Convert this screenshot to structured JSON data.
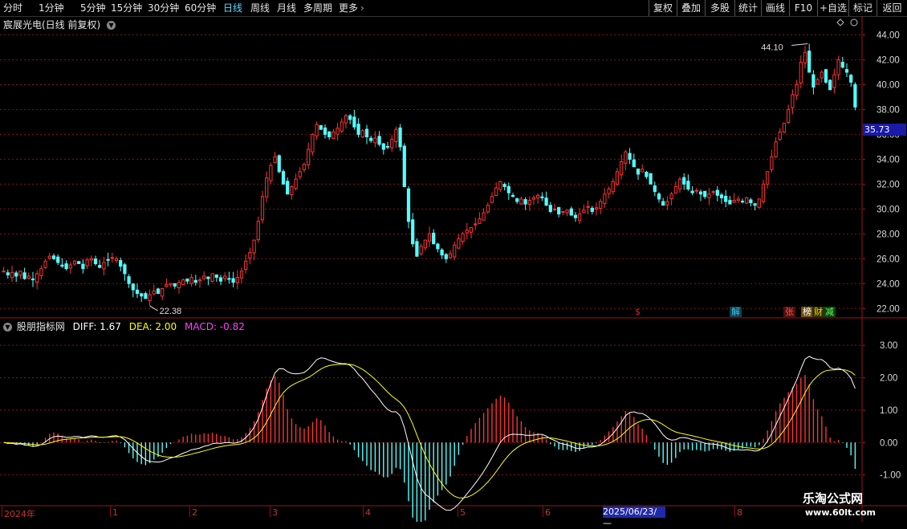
{
  "toolbar": {
    "periods": [
      "分时",
      "1分钟",
      "5分钟",
      "15分钟",
      "30分钟",
      "60分钟",
      "日线",
      "周线",
      "月线",
      "多周期",
      "更多"
    ],
    "active_period": "日线",
    "right_buttons": [
      "复权",
      "叠加",
      "多股",
      "统计",
      "画线",
      "F10",
      "+自选",
      "标记",
      "返回"
    ]
  },
  "stock": {
    "title": "宸展光电(日线 前复权)",
    "current_price_tag": "35.73"
  },
  "indicator": {
    "name": "股朋指标网",
    "diff": "DIFF: 1.67",
    "dea": "DEA: 2.00",
    "macd": "MACD: -0.82"
  },
  "annotations": {
    "high_label": "44.10",
    "low_label": "22.38"
  },
  "badges": [
    {
      "text": "$",
      "color": "#e02020",
      "bg": "transparent"
    },
    {
      "text": "解",
      "color": "#40c0e0",
      "bg": "#104050"
    },
    {
      "text": "张",
      "color": "#ff5050",
      "bg": "#501010"
    },
    {
      "text": "榜",
      "color": "#ffffff",
      "bg": "#705010"
    },
    {
      "text": "财",
      "color": "#ffd000",
      "bg": "#303000"
    },
    {
      "text": "减",
      "color": "#60ff60",
      "bg": "#104010"
    }
  ],
  "dates": [
    "2024年",
    "1",
    "2",
    "3",
    "4",
    "5",
    "6",
    "2025/06/23/—",
    "8"
  ],
  "watermark": {
    "title": "乐淘公式网",
    "url": "www.60lt.com"
  },
  "colors": {
    "up": "#ff3232",
    "down": "#54ffff",
    "diff_line": "#ffffff",
    "dea_line": "#ffff00",
    "macd_text": "#ff40ff",
    "grid": "#8a1010"
  },
  "chart_data": {
    "type": "candlestick",
    "price_axis": {
      "ticks": [
        "44.00",
        "42.00",
        "40.00",
        "38.00",
        "36.00",
        "34.00",
        "32.00",
        "30.00",
        "28.00",
        "26.00",
        "24.00",
        "22.00"
      ],
      "ylim": [
        21.5,
        45.0
      ]
    },
    "macd_axis": {
      "ticks": [
        "3.00",
        "2.00",
        "1.00",
        "0.00",
        "-1.00"
      ],
      "ylim": [
        -1.9,
        3.5
      ]
    },
    "close_series": [
      25.0,
      24.7,
      24.9,
      24.6,
      25.0,
      24.4,
      24.6,
      24.3,
      24.8,
      25.2,
      25.8,
      26.2,
      26.0,
      25.7,
      25.4,
      25.2,
      25.5,
      25.8,
      25.6,
      25.2,
      25.9,
      26.0,
      25.6,
      25.3,
      25.7,
      25.9,
      26.1,
      26.0,
      25.4,
      24.8,
      24.0,
      23.5,
      23.2,
      23.0,
      22.8,
      23.1,
      23.4,
      23.2,
      23.6,
      23.9,
      24.0,
      23.8,
      24.1,
      24.3,
      24.2,
      24.5,
      24.1,
      24.3,
      24.6,
      24.4,
      24.8,
      24.5,
      24.2,
      24.6,
      24.4,
      24.1,
      24.5,
      25.0,
      25.8,
      26.5,
      27.5,
      29.0,
      31.0,
      32.5,
      33.5,
      34.2,
      33.0,
      32.0,
      31.2,
      31.8,
      32.4,
      33.0,
      33.6,
      34.8,
      36.0,
      36.8,
      36.4,
      36.0,
      35.8,
      36.2,
      36.5,
      37.0,
      37.5,
      37.2,
      36.6,
      36.0,
      36.3,
      35.8,
      35.5,
      35.7,
      35.2,
      34.8,
      35.0,
      35.6,
      36.4,
      35.0,
      31.8,
      29.0,
      27.2,
      26.2,
      27.0,
      27.5,
      28.0,
      27.2,
      26.8,
      26.3,
      26.0,
      26.4,
      27.1,
      27.6,
      28.0,
      28.3,
      28.5,
      28.8,
      29.2,
      29.7,
      30.3,
      31.0,
      31.7,
      32.2,
      31.8,
      31.3,
      31.0,
      30.6,
      30.8,
      30.4,
      30.7,
      30.9,
      31.1,
      30.9,
      30.3,
      29.8,
      30.0,
      29.6,
      29.8,
      29.9,
      29.5,
      29.3,
      29.6,
      29.9,
      30.2,
      29.8,
      30.1,
      30.6,
      31.2,
      31.6,
      32.2,
      33.0,
      33.8,
      34.6,
      34.0,
      33.4,
      32.8,
      33.2,
      32.6,
      32.0,
      31.4,
      30.8,
      30.3,
      30.6,
      31.2,
      31.8,
      32.4,
      32.0,
      31.6,
      31.3,
      31.5,
      31.2,
      31.0,
      31.2,
      31.4,
      31.1,
      30.9,
      30.6,
      30.4,
      30.7,
      30.8,
      30.6,
      30.9,
      30.5,
      30.3,
      30.8,
      32.0,
      33.0,
      34.2,
      35.4,
      36.2,
      36.9,
      38.0,
      39.2,
      40.0,
      41.8,
      42.6,
      41.0,
      39.8,
      40.4,
      41.0,
      40.2,
      39.6,
      40.8,
      42.0,
      41.4,
      41.0,
      40.2,
      38.2
    ]
  }
}
